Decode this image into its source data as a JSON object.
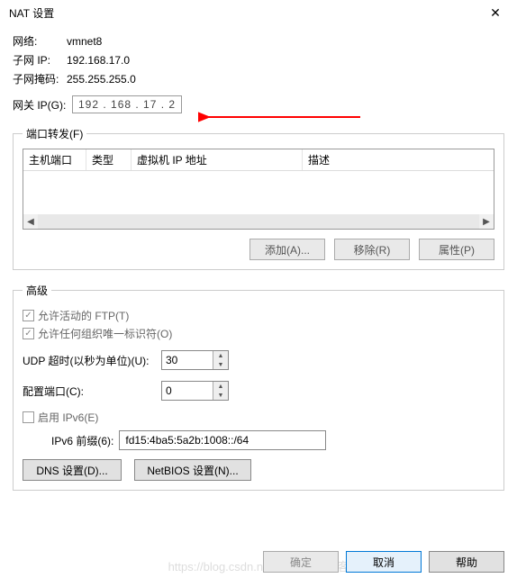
{
  "title": "NAT 设置",
  "close_glyph": "✕",
  "info": {
    "network_label": "网络:",
    "network_value": "vmnet8",
    "subnet_ip_label": "子网 IP:",
    "subnet_ip_value": "192.168.17.0",
    "subnet_mask_label": "子网掩码:",
    "subnet_mask_value": "255.255.255.0",
    "gateway_label": "网关 IP(G):",
    "gateway_value": "192 . 168 . 17  .  2"
  },
  "port_forward": {
    "legend": "端口转发(F)",
    "cols": {
      "host": "主机端口",
      "type": "类型",
      "vmip": "虚拟机 IP 地址",
      "desc": "描述"
    },
    "buttons": {
      "add": "添加(A)...",
      "remove": "移除(R)",
      "props": "属性(P)"
    }
  },
  "advanced": {
    "legend": "高级",
    "ftp_label": "允许活动的 FTP(T)",
    "org_label": "允许任何组织唯一标识符(O)",
    "udp_label": "UDP 超时(以秒为单位)(U):",
    "udp_value": "30",
    "cfg_port_label": "配置端口(C):",
    "cfg_port_value": "0",
    "ipv6_enable_label": "启用 IPv6(E)",
    "ipv6_prefix_label": "IPv6 前缀(6):",
    "ipv6_prefix_value": "fd15:4ba5:5a2b:1008::/64",
    "dns_btn": "DNS 设置(D)...",
    "netbios_btn": "NetBIOS 设置(N)..."
  },
  "footer": {
    "ok": "确定",
    "cancel": "取消",
    "help": "帮助"
  },
  "watermark": "https://blog.csdn.net/@51CTO博客"
}
